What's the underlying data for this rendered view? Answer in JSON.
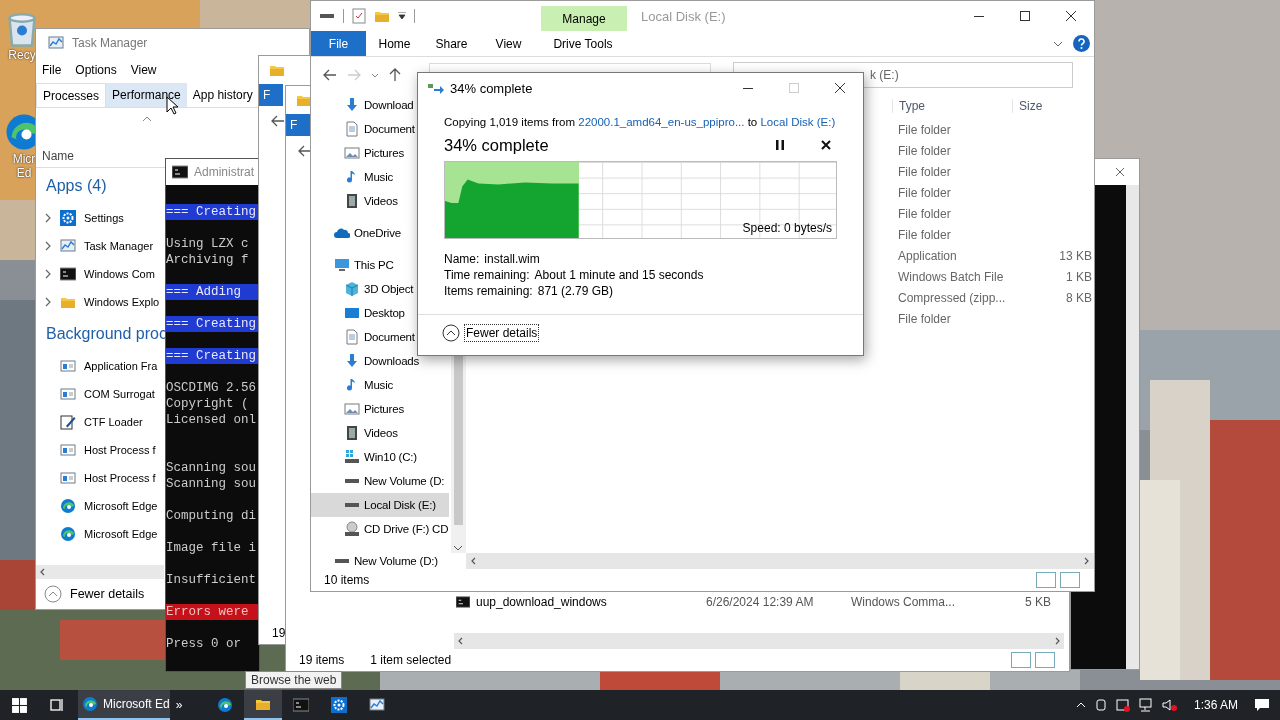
{
  "desktop": {
    "icons": [
      {
        "kind": "recycle-bin",
        "label_lines": [
          "Recy"
        ]
      },
      {
        "kind": "edge",
        "label_lines": [
          "Micr",
          "Ed"
        ]
      }
    ]
  },
  "task_manager": {
    "title": "Task Manager",
    "menu": [
      "File",
      "Options",
      "View"
    ],
    "tabs": [
      {
        "label": "Processes",
        "selected": true,
        "hovered": false
      },
      {
        "label": "Performance",
        "selected": false,
        "hovered": true
      },
      {
        "label": "App history",
        "selected": false,
        "hovered": false
      }
    ],
    "column": "Name",
    "groups": [
      {
        "title": "Apps (4)",
        "items": [
          {
            "name": "Settings",
            "kind": "gear",
            "expandable": true
          },
          {
            "name": "Task Manager",
            "kind": "taskmgr",
            "expandable": true
          },
          {
            "name": "Windows Com",
            "kind": "cmd",
            "expandable": true
          },
          {
            "name": "Windows Explo",
            "kind": "explorer",
            "expandable": true
          }
        ]
      },
      {
        "title": "Background proc",
        "items": [
          {
            "name": "Application Fra",
            "kind": "app",
            "expandable": false
          },
          {
            "name": "COM Surrogat",
            "kind": "app",
            "expandable": false
          },
          {
            "name": "CTF Loader",
            "kind": "pen",
            "expandable": false
          },
          {
            "name": "Host Process f",
            "kind": "app",
            "expandable": false
          },
          {
            "name": "Host Process f",
            "kind": "app",
            "expandable": false
          },
          {
            "name": "Microsoft Edge",
            "kind": "edge",
            "expandable": false
          },
          {
            "name": "Microsoft Edge",
            "kind": "edge",
            "expandable": false
          }
        ]
      }
    ],
    "footer": "Fewer details"
  },
  "console": {
    "title": "Administrat",
    "lines": [
      {
        "kind": "highlight",
        "text": "=== Creating"
      },
      {
        "kind": "blank"
      },
      {
        "kind": "plain",
        "text": "Using LZX c"
      },
      {
        "kind": "plain",
        "text": "Archiving f"
      },
      {
        "kind": "blank"
      },
      {
        "kind": "highlight",
        "text": "=== Adding"
      },
      {
        "kind": "blank"
      },
      {
        "kind": "highlight",
        "text": "=== Creating"
      },
      {
        "kind": "blank"
      },
      {
        "kind": "highlight",
        "text": "=== Creating"
      },
      {
        "kind": "blank"
      },
      {
        "kind": "plain",
        "text": "OSCDIMG 2.56"
      },
      {
        "kind": "plain",
        "text": "Copyright ("
      },
      {
        "kind": "plain",
        "text": "Licensed onl"
      },
      {
        "kind": "blank"
      },
      {
        "kind": "blank"
      },
      {
        "kind": "plain",
        "text": "Scanning sou"
      },
      {
        "kind": "plain",
        "text": "Scanning sou"
      },
      {
        "kind": "blank"
      },
      {
        "kind": "plain",
        "text": "Computing di"
      },
      {
        "kind": "blank"
      },
      {
        "kind": "plain",
        "text": "Image file i"
      },
      {
        "kind": "blank"
      },
      {
        "kind": "plain",
        "text": "Insufficient"
      },
      {
        "kind": "blank"
      },
      {
        "kind": "error",
        "text": "Errors were"
      },
      {
        "kind": "blank"
      },
      {
        "kind": "plain",
        "text": "Press 0 or"
      }
    ]
  },
  "explorer_back_1": {
    "file_tab": "F",
    "status": "19"
  },
  "explorer_back_2": {
    "file_tab": "F",
    "row": {
      "name": "uup_download_windows",
      "date": "6/26/2024 12:39 AM",
      "type": "Windows Comma...",
      "size": "5 KB"
    },
    "status": [
      "19 items",
      "1 item selected"
    ]
  },
  "explorer": {
    "context_tab": "Manage",
    "title": "Local Disk (E:)",
    "ribbon_tabs": [
      {
        "label": "File",
        "kind": "file"
      },
      {
        "label": "Home",
        "kind": "tab"
      },
      {
        "label": "Share",
        "kind": "tab"
      },
      {
        "label": "View",
        "kind": "tab"
      },
      {
        "label": "Drive Tools",
        "kind": "context"
      }
    ],
    "search_text": "k (E:)",
    "quick_access_children": [
      {
        "label": "Download",
        "kind": "download",
        "selected": false
      },
      {
        "label": "Document",
        "kind": "document",
        "selected": false
      },
      {
        "label": "Pictures",
        "kind": "pictures",
        "selected": false
      },
      {
        "label": "Music",
        "kind": "music",
        "selected": false
      },
      {
        "label": "Videos",
        "kind": "videos",
        "selected": false
      }
    ],
    "tree": [
      {
        "label": "OneDrive",
        "kind": "onedrive",
        "selected": false
      },
      {
        "label": "This PC",
        "kind": "pc",
        "selected": false,
        "children": [
          {
            "label": "3D Object",
            "kind": "objects",
            "selected": false
          },
          {
            "label": "Desktop",
            "kind": "desktop",
            "selected": false
          },
          {
            "label": "Document",
            "kind": "document",
            "selected": false
          },
          {
            "label": "Downloads",
            "kind": "download",
            "selected": false
          },
          {
            "label": "Music",
            "kind": "music",
            "selected": false
          },
          {
            "label": "Pictures",
            "kind": "pictures",
            "selected": false
          },
          {
            "label": "Videos",
            "kind": "videos",
            "selected": false
          },
          {
            "label": "Win10 (C:)",
            "kind": "drive-sys",
            "selected": false
          },
          {
            "label": "New Volume (D:",
            "kind": "drive",
            "selected": false
          },
          {
            "label": "Local Disk (E:)",
            "kind": "drive",
            "selected": true
          },
          {
            "label": "CD Drive (F:) CD",
            "kind": "cd",
            "selected": false
          }
        ]
      },
      {
        "label": "New Volume (D:)",
        "kind": "drive",
        "selected": false
      }
    ],
    "columns": [
      "Type",
      "Size"
    ],
    "rows": [
      {
        "type": "File folder"
      },
      {
        "type": "File folder"
      },
      {
        "type": "File folder"
      },
      {
        "type": "File folder"
      },
      {
        "type": "File folder"
      },
      {
        "type": "File folder"
      },
      {
        "type": "Application",
        "size": "13 KB"
      },
      {
        "type": "Windows Batch File",
        "size": "1 KB"
      },
      {
        "type": "Compressed (zipp...",
        "size": "8 KB"
      },
      {
        "type": "File folder"
      }
    ],
    "status": "10 items"
  },
  "copy_dialog": {
    "title": "34% complete",
    "controls": [
      {
        "kind": "minimize",
        "disabled": false
      },
      {
        "kind": "maximize",
        "disabled": true
      },
      {
        "kind": "close",
        "disabled": false
      }
    ],
    "summary": {
      "prefix": "Copying 1,019 items from ",
      "source": "22000.1_amd64_en-us_ppipro...",
      "middle": " to ",
      "destination": "Local Disk (E:)"
    },
    "heading": "34% complete",
    "progress": {
      "level": 0.34
    },
    "speed": "Speed: 0 bytes/s",
    "details": [
      {
        "label": "Name:",
        "value": "install.wim"
      },
      {
        "label": "Time remaining:",
        "value": "About 1 minute and 15 seconds"
      },
      {
        "label": "Items remaining:",
        "value": "871 (2.79 GB)"
      }
    ],
    "toggle": "Fewer details"
  },
  "tooltip": "Browse the web",
  "taskbar": {
    "items": [
      {
        "kind": "start",
        "active": false
      },
      {
        "kind": "task-view",
        "active": false
      },
      {
        "kind": "app",
        "label": "Microsoft Ed",
        "active": true
      },
      {
        "kind": "overflow",
        "label": "»",
        "active": false
      },
      {
        "kind": "edge",
        "active": false
      },
      {
        "kind": "explorer",
        "active": true
      },
      {
        "kind": "cmd",
        "active": false
      },
      {
        "kind": "gear",
        "active": false
      },
      {
        "kind": "taskmgr",
        "active": false
      }
    ],
    "clock": "1:36 AM"
  }
}
